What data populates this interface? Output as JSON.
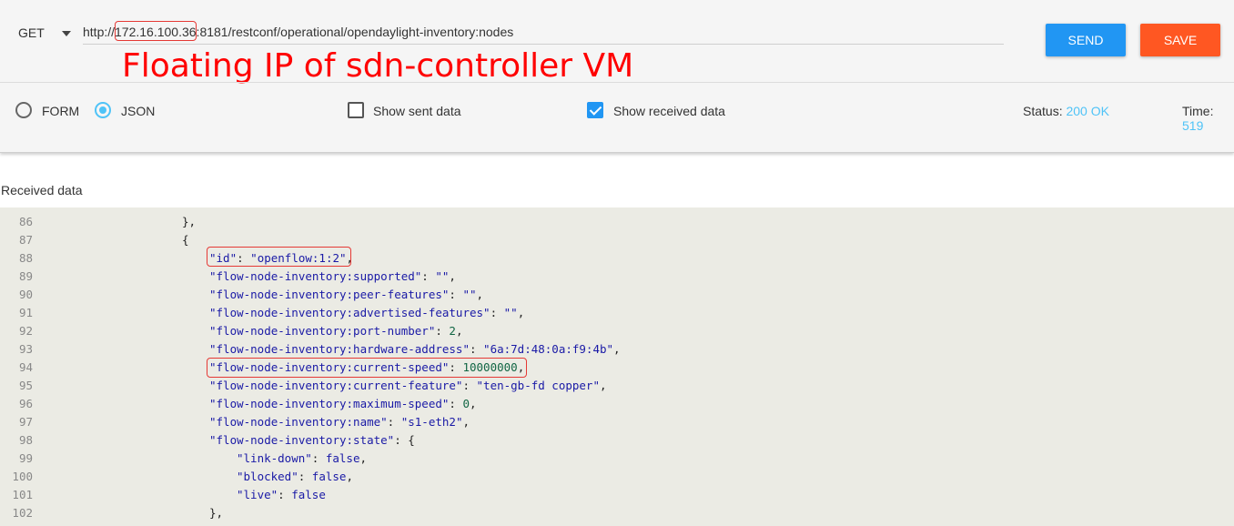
{
  "request": {
    "method": "GET",
    "url": "http://172.16.100.36:8181/restconf/operational/opendaylight-inventory:nodes",
    "annotation": "Floating IP of sdn-controller VM",
    "send_label": "SEND",
    "save_label": "SAVE"
  },
  "options": {
    "form_label": "FORM",
    "json_label": "JSON",
    "selected": "JSON",
    "show_sent_label": "Show sent data",
    "show_sent_checked": false,
    "show_received_label": "Show received data",
    "show_received_checked": true
  },
  "status": {
    "label": "Status:",
    "value": "200 OK",
    "time_label": "Time:",
    "time_value": "519"
  },
  "received": {
    "label": "Received data",
    "lines": [
      {
        "n": "86",
        "indent": 0,
        "text": "},"
      },
      {
        "n": "87",
        "indent": 0,
        "text": "{"
      },
      {
        "n": "88",
        "indent": 1,
        "key": "\"id\"",
        "sep": ": ",
        "val": "\"openflow:1:2\"",
        "vt": "s",
        "tail": ","
      },
      {
        "n": "89",
        "indent": 1,
        "key": "\"flow-node-inventory:supported\"",
        "sep": ": ",
        "val": "\"\"",
        "vt": "s",
        "tail": ","
      },
      {
        "n": "90",
        "indent": 1,
        "key": "\"flow-node-inventory:peer-features\"",
        "sep": ": ",
        "val": "\"\"",
        "vt": "s",
        "tail": ","
      },
      {
        "n": "91",
        "indent": 1,
        "key": "\"flow-node-inventory:advertised-features\"",
        "sep": ": ",
        "val": "\"\"",
        "vt": "s",
        "tail": ","
      },
      {
        "n": "92",
        "indent": 1,
        "key": "\"flow-node-inventory:port-number\"",
        "sep": ": ",
        "val": "2",
        "vt": "n",
        "tail": ","
      },
      {
        "n": "93",
        "indent": 1,
        "key": "\"flow-node-inventory:hardware-address\"",
        "sep": ": ",
        "val": "\"6a:7d:48:0a:f9:4b\"",
        "vt": "s",
        "tail": ","
      },
      {
        "n": "94",
        "indent": 1,
        "key": "\"flow-node-inventory:current-speed\"",
        "sep": ": ",
        "val": "10000000",
        "vt": "n",
        "tail": ","
      },
      {
        "n": "95",
        "indent": 1,
        "key": "\"flow-node-inventory:current-feature\"",
        "sep": ": ",
        "val": "\"ten-gb-fd copper\"",
        "vt": "s",
        "tail": ","
      },
      {
        "n": "96",
        "indent": 1,
        "key": "\"flow-node-inventory:maximum-speed\"",
        "sep": ": ",
        "val": "0",
        "vt": "n",
        "tail": ","
      },
      {
        "n": "97",
        "indent": 1,
        "key": "\"flow-node-inventory:name\"",
        "sep": ": ",
        "val": "\"s1-eth2\"",
        "vt": "s",
        "tail": ","
      },
      {
        "n": "98",
        "indent": 1,
        "key": "\"flow-node-inventory:state\"",
        "sep": ": ",
        "val": "{",
        "vt": "p",
        "tail": ""
      },
      {
        "n": "99",
        "indent": 2,
        "key": "\"link-down\"",
        "sep": ": ",
        "val": "false",
        "vt": "b",
        "tail": ","
      },
      {
        "n": "100",
        "indent": 2,
        "key": "\"blocked\"",
        "sep": ": ",
        "val": "false",
        "vt": "b",
        "tail": ","
      },
      {
        "n": "101",
        "indent": 2,
        "key": "\"live\"",
        "sep": ": ",
        "val": "false",
        "vt": "b",
        "tail": ""
      },
      {
        "n": "102",
        "indent": 1,
        "text": "},"
      }
    ]
  },
  "colors": {
    "send": "#2196f3",
    "save": "#ff5722",
    "accent": "#4fc3f7",
    "annotation": "#ff0000"
  }
}
